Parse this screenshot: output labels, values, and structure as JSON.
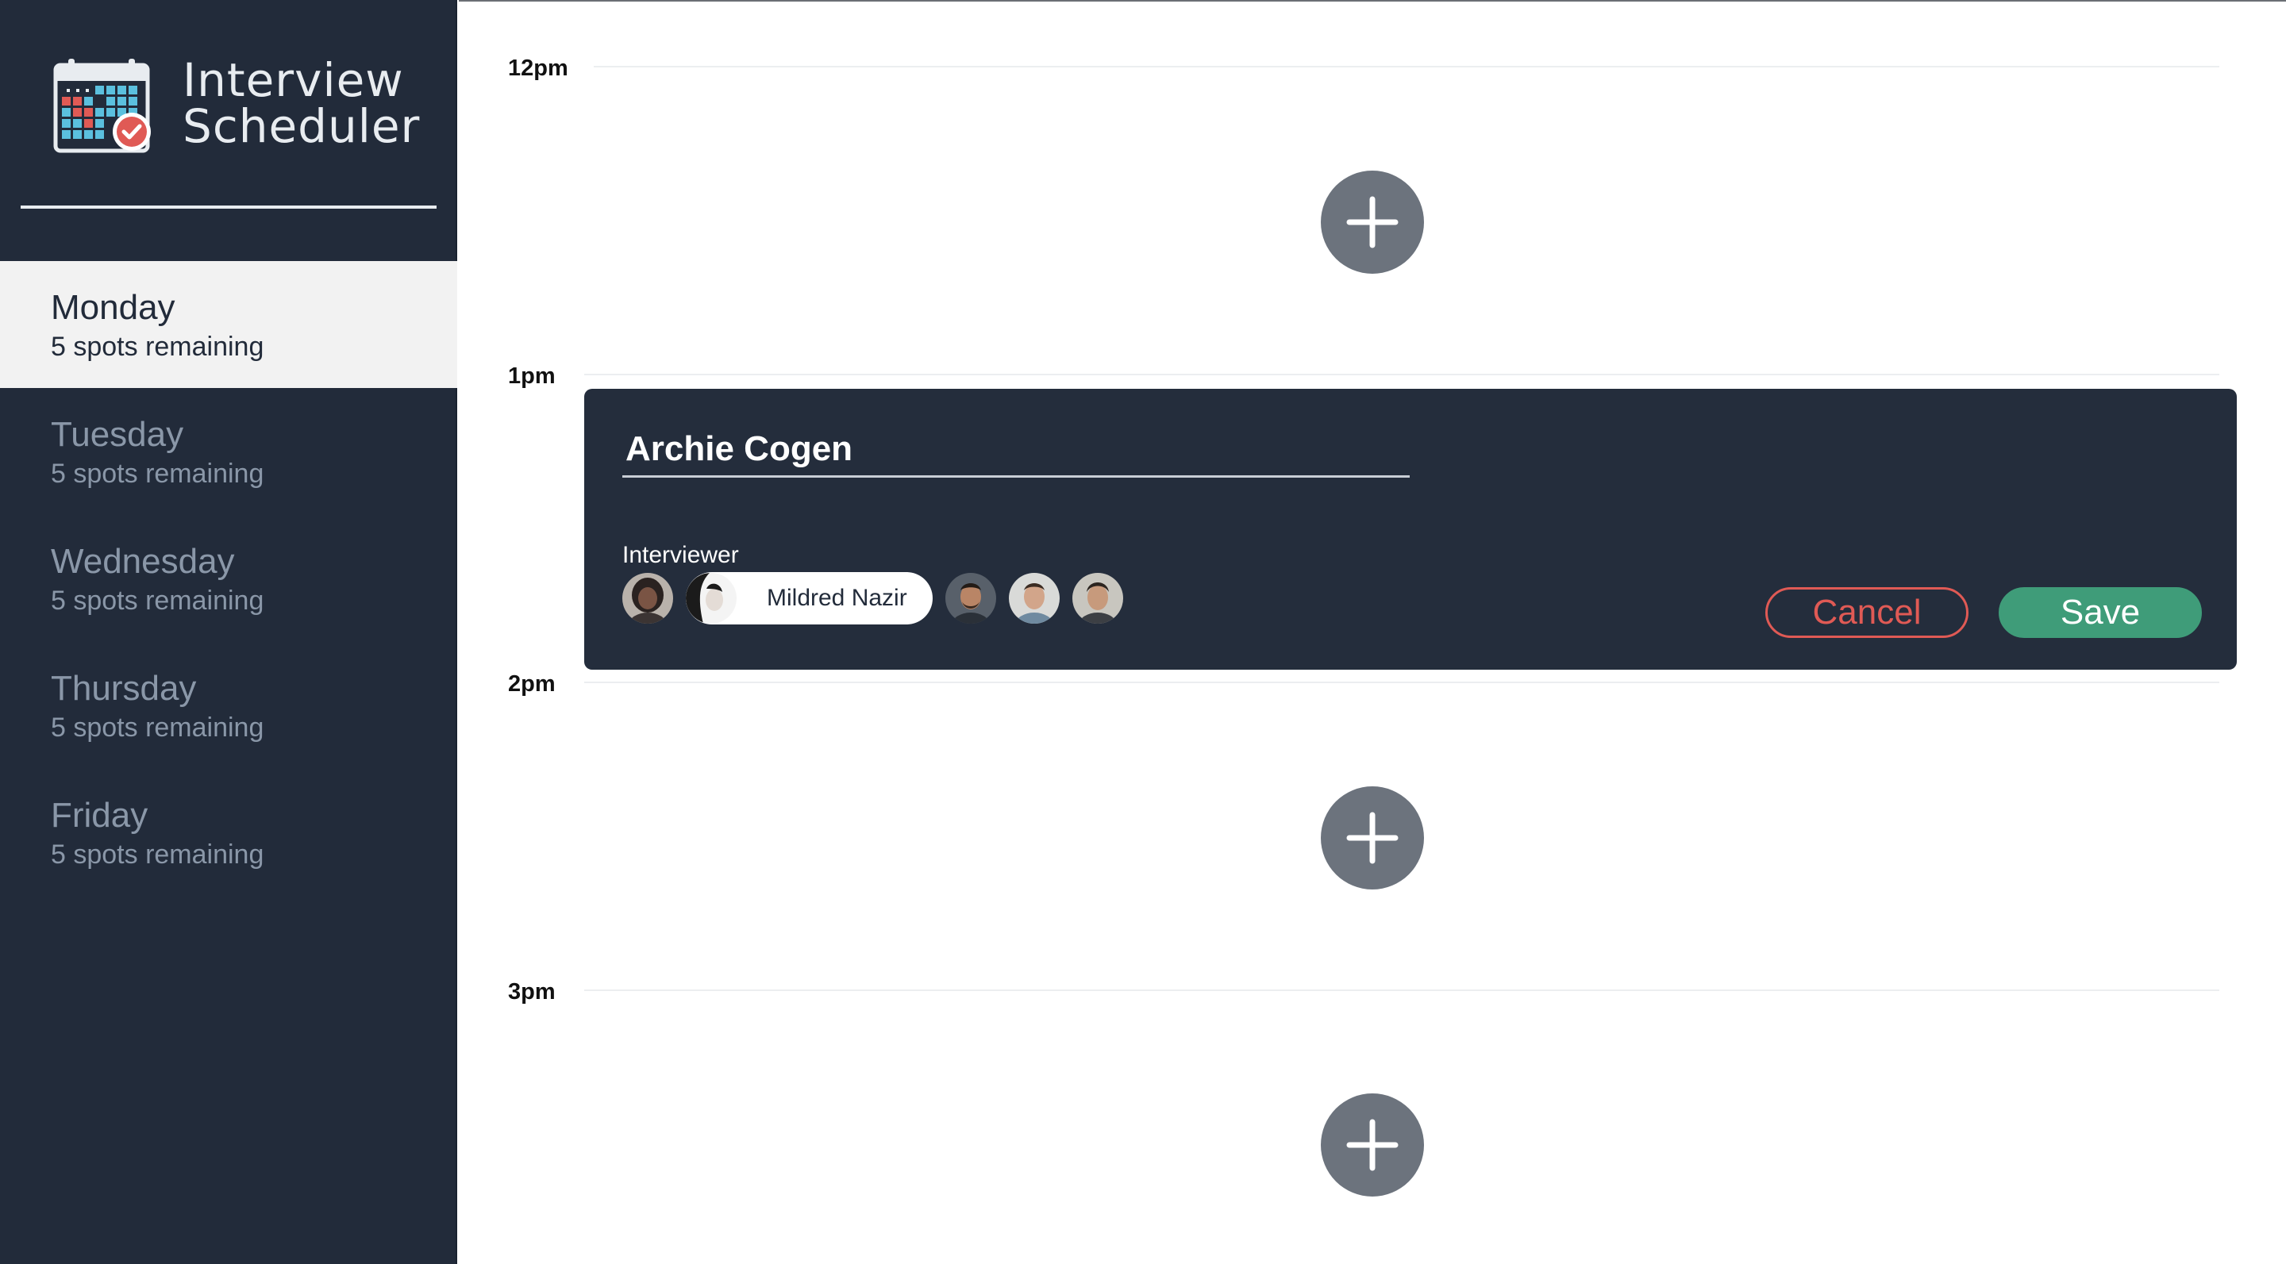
{
  "app": {
    "title_line1": "Interview",
    "title_line2": "Scheduler"
  },
  "sidebar": {
    "days": [
      {
        "name": "Monday",
        "spots": "5 spots remaining",
        "selected": true
      },
      {
        "name": "Tuesday",
        "spots": "5 spots remaining",
        "selected": false
      },
      {
        "name": "Wednesday",
        "spots": "5 spots remaining",
        "selected": false
      },
      {
        "name": "Thursday",
        "spots": "5 spots remaining",
        "selected": false
      },
      {
        "name": "Friday",
        "spots": "5 spots remaining",
        "selected": false
      }
    ]
  },
  "schedule": {
    "slots": [
      {
        "time": "12pm",
        "state": "empty"
      },
      {
        "time": "1pm",
        "state": "form"
      },
      {
        "time": "2pm",
        "state": "empty"
      },
      {
        "time": "3pm",
        "state": "empty"
      }
    ],
    "add_icon": "plus-icon"
  },
  "form": {
    "student_name": "Archie Cogen",
    "interviewer_label": "Interviewer",
    "interviewers": [
      {
        "id": 1,
        "icon": "avatar-photo",
        "selected": false
      },
      {
        "id": 2,
        "name": "Mildred Nazir",
        "icon": "avatar-photo",
        "selected": true
      },
      {
        "id": 3,
        "icon": "avatar-photo",
        "selected": false
      },
      {
        "id": 4,
        "icon": "avatar-photo",
        "selected": false
      },
      {
        "id": 5,
        "icon": "avatar-photo",
        "selected": false
      }
    ],
    "cancel_label": "Cancel",
    "save_label": "Save"
  },
  "colors": {
    "sidebar_bg": "#222b3a",
    "selected_day_bg": "#f2f2f2",
    "add_button": "#6c737d",
    "cancel": "#e05a55",
    "save": "#3f9c79"
  }
}
